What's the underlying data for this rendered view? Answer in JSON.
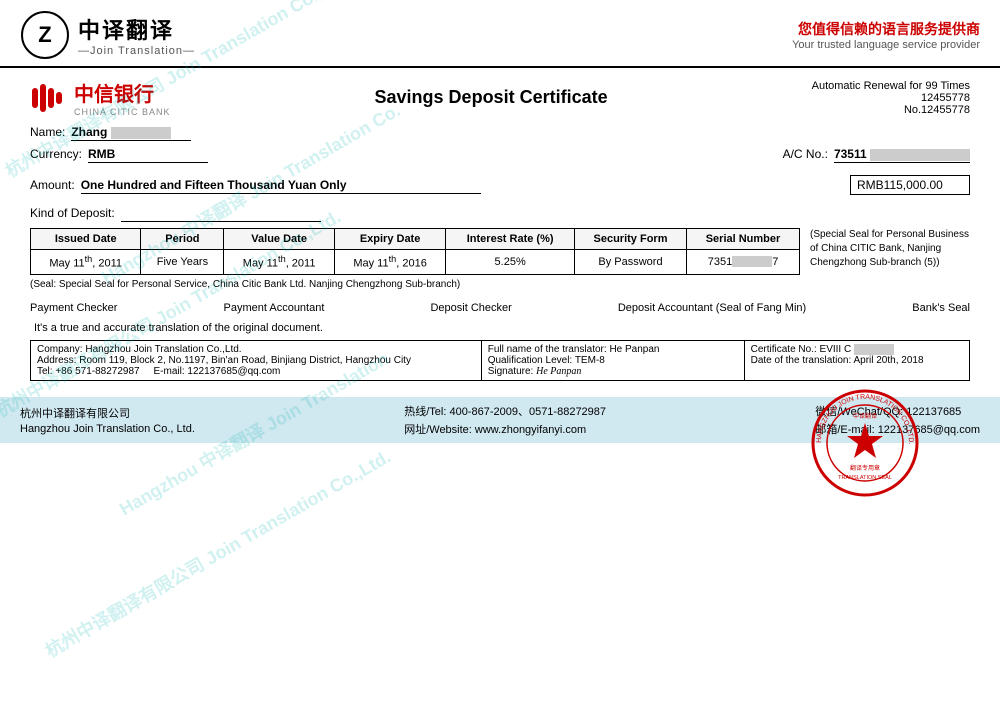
{
  "header": {
    "logo_cn": "中译翻译",
    "logo_en": "—Join Translation—",
    "tagline_cn": "您值得信赖的语言服务提供商",
    "tagline_en": "Your trusted language service provider"
  },
  "document": {
    "bank_name_cn": "中信银行",
    "bank_name_en": "CHINA CITIC BANK",
    "title": "Savings Deposit Certificate",
    "renewal": "Automatic Renewal for 99 Times",
    "cert_no_prefix": "12455778",
    "cert_no": "No.12455778",
    "name_label": "Name:",
    "name_value": "Zhang",
    "currency_label": "Currency:",
    "currency_value": "RMB",
    "amount_label": "Amount:",
    "amount_value": "One Hundred and Fifteen Thousand Yuan Only",
    "amount_rmb": "RMB115,000.00",
    "ac_label": "A/C No.:",
    "ac_value": "73511",
    "deposit_kind_label": "Kind of Deposit:",
    "table": {
      "headers": [
        "Issued Date",
        "Period",
        "Value Date",
        "Expiry Date",
        "Interest Rate (%)",
        "Security Form",
        "Serial Number"
      ],
      "row": [
        "May 11th, 2011",
        "Five Years",
        "May 11th, 2011",
        "May 11th, 2016",
        "5.25%",
        "By Password",
        "7351"
      ]
    },
    "special_seal": "(Special Seal for Personal Business of China CITIC Bank, Nanjing Chengzhong Sub-branch (5))",
    "seal_note": "(Seal: Special Seal for Personal Service, China Citic Bank Ltd. Nanjing Chengzhong Sub-branch)",
    "payment_checker": "Payment Checker",
    "payment_accountant": "Payment Accountant",
    "deposit_checker": "Deposit Checker",
    "deposit_accountant": "Deposit Accountant (Seal of Fang Min)",
    "bank_seal": "Bank's Seal"
  },
  "accuracy_note": "It's a true and accurate translation of the original document.",
  "company_info": {
    "company": "Company: Hangzhou Join Translation Co.,Ltd.",
    "address": "Address: Room 119, Block 2, No.1197, Bin'an Road, Binjiang District, Hangzhou City",
    "tel": "Tel: +86 571-88272987",
    "email": "E-mail: 122137685@qq.com",
    "translator_label": "Full name of the translator:",
    "translator_name": "He Panpan",
    "qualification_label": "Qualification Level:",
    "qualification_value": "TEM-8",
    "signature_label": "Signature:",
    "cert_no_label": "Certificate No.: EVIII C",
    "translation_date": "Date of the translation: April 20th, 2018"
  },
  "footer": {
    "org_cn": "杭州中译翻译有限公司",
    "org_en": "Hangzhou Join Translation Co., Ltd.",
    "hotline_label": "热线/Tel:",
    "hotline": "400-867-2009、0571-88272987",
    "website_label": "网址/Website:",
    "website": "www.zhongyifanyi.com",
    "wechat_label": "微信/WeChat/QQ:",
    "wechat": "122137685",
    "email_label": "邮箱/E-mail:",
    "email": "122137685@qq.com"
  }
}
